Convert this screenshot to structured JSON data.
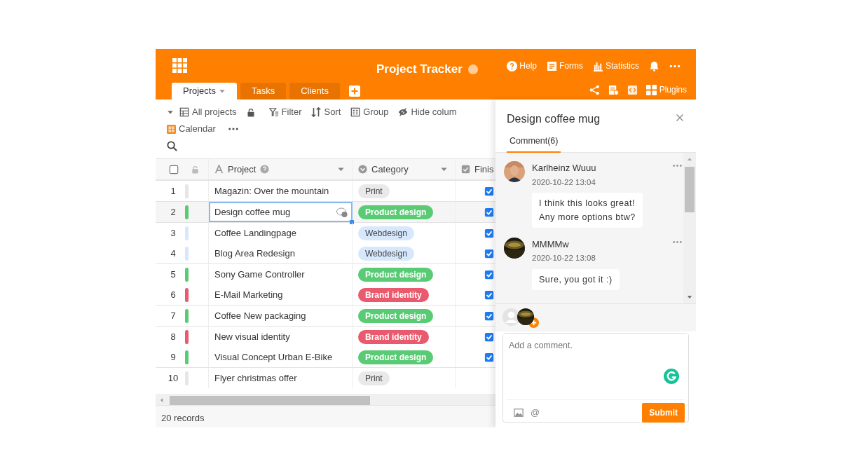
{
  "header": {
    "title": "Project Tracker",
    "actions": [
      {
        "kind": "help",
        "label": "Help"
      },
      {
        "kind": "forms",
        "label": "Forms"
      },
      {
        "kind": "statistics",
        "label": "Statistics"
      },
      {
        "kind": "bell"
      },
      {
        "kind": "more"
      }
    ],
    "tools": [
      {
        "kind": "share"
      },
      {
        "kind": "form"
      },
      {
        "kind": "code"
      },
      {
        "kind": "plugins",
        "label": "Plugins"
      }
    ]
  },
  "tabs": [
    {
      "label": "Projects",
      "selected": true
    },
    {
      "label": "Tasks",
      "selected": false
    },
    {
      "label": "Clients",
      "selected": false
    }
  ],
  "toolbar": {
    "view": "All projects",
    "items": [
      {
        "kind": "filter",
        "label": "Filter"
      },
      {
        "kind": "sort",
        "label": "Sort"
      },
      {
        "kind": "group",
        "label": "Group"
      },
      {
        "kind": "hide",
        "label": "Hide colum"
      }
    ],
    "calendar": "Calendar"
  },
  "table": {
    "select_all": {
      "checked": false
    },
    "columns": [
      {
        "kind": "text",
        "label": "Project"
      },
      {
        "kind": "select",
        "label": "Category"
      },
      {
        "kind": "checkbox",
        "label": "Finis"
      }
    ],
    "rows": [
      {
        "number": "1",
        "color": "#e6e6e6",
        "project": "Magazin: Over the mountain",
        "category": {
          "label": "Print",
          "color": "#e9e9e9"
        },
        "finished": true,
        "selected": false,
        "group_start": true
      },
      {
        "number": "2",
        "color": "#59cb74",
        "project": "Design coffee mug",
        "category": {
          "label": "Product design",
          "color": "#59cb74"
        },
        "finished": true,
        "selected": true,
        "group_start": true
      },
      {
        "number": "3",
        "color": "#d7e8fd",
        "project": "Coffee Landingpage",
        "category": {
          "label": "Webdesign",
          "color": "#d7e8fd"
        },
        "finished": true,
        "selected": false,
        "group_start": true
      },
      {
        "number": "4",
        "color": "#d7e8fd",
        "project": "Blog Area Redesign",
        "category": {
          "label": "Webdesign",
          "color": "#d7e8fd"
        },
        "finished": true,
        "selected": false,
        "group_start": false
      },
      {
        "number": "5",
        "color": "#59cb74",
        "project": "Sony Game Controller",
        "category": {
          "label": "Product design",
          "color": "#59cb74"
        },
        "finished": true,
        "selected": false,
        "group_start": true
      },
      {
        "number": "6",
        "color": "#ea5a6f",
        "project": "E-Mail Marketing",
        "category": {
          "label": "Brand identity",
          "color": "#ea5a6f"
        },
        "finished": true,
        "selected": false,
        "group_start": false
      },
      {
        "number": "7",
        "color": "#59cb74",
        "project": "Coffee New packaging",
        "category": {
          "label": "Product design",
          "color": "#59cb74"
        },
        "finished": true,
        "selected": false,
        "group_start": true
      },
      {
        "number": "8",
        "color": "#ea5a6f",
        "project": "New visual identity",
        "category": {
          "label": "Brand identity",
          "color": "#ea5a6f"
        },
        "finished": true,
        "selected": false,
        "group_start": true
      },
      {
        "number": "9",
        "color": "#59cb74",
        "project": "Visual Concept Urban E-Bike",
        "category": {
          "label": "Product design",
          "color": "#59cb74"
        },
        "finished": true,
        "selected": false,
        "group_start": false
      },
      {
        "number": "10",
        "color": "#e6e6e6",
        "project": "Flyer christmas offer",
        "category": {
          "label": "Print",
          "color": "#e9e9e9"
        },
        "finished": false,
        "selected": false,
        "group_start": true
      }
    ]
  },
  "status_bar": "20 records",
  "panel": {
    "title": "Design coffee mug",
    "tab": "Comment(6)",
    "comments": [
      {
        "author": "Karlheinz Wuuu",
        "time": "2020-10-22 13:04",
        "text": "I think this looks great!\nAny more options btw?"
      },
      {
        "author": "MMMMw",
        "time": "2020-10-22 13:08",
        "text": "Sure, you got it :)"
      }
    ],
    "composer": {
      "placeholder": "Add a comment.",
      "mention": "@",
      "submit": "Submit"
    }
  }
}
